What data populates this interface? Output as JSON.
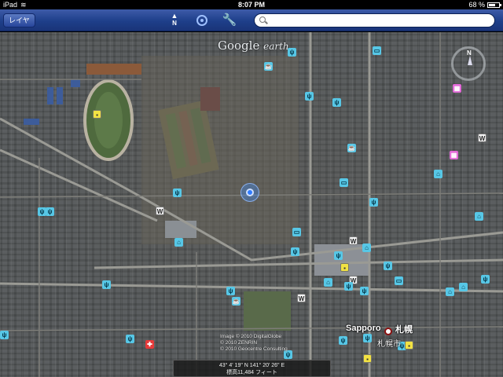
{
  "status_bar": {
    "device": "iPad",
    "time": "8:07 PM",
    "battery_text": "68 %",
    "battery_level": 0.68
  },
  "toolbar": {
    "layers_label": "レイヤ",
    "north_label": "N",
    "search_placeholder": "",
    "search_value": ""
  },
  "map": {
    "brand_google": "Google",
    "brand_earth": "earth",
    "compass_label": "N",
    "city_label": "Sapporo",
    "city_label_ja": "札幌",
    "city_sub_ja": "札幌市",
    "attribution": [
      "Image © 2010 DigitalGlobe",
      "© 2010 ZENRIN",
      "© 2010 Geocentre Consulting"
    ],
    "coordinates": "43° 4' 19\" N  141° 20' 26\" E",
    "altitude": "標高11,484 フィート"
  },
  "colors": {
    "toolbar": "#1e3f8a",
    "poi_blue": "#57c7e6",
    "poi_pink": "#e26ad8",
    "poi_yellow": "#f2e243",
    "location": "#2f7bff"
  },
  "icons": {
    "food": "fork-knife-icon",
    "shop": "shopping-bag-icon",
    "cafe": "coffee-cup-icon",
    "hotel": "bed-icon",
    "film": "film-icon",
    "wiki": "wikipedia-icon"
  }
}
